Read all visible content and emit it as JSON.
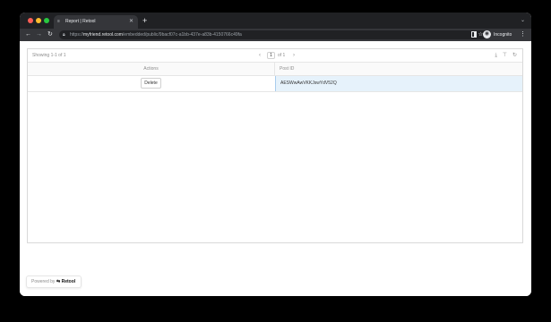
{
  "browser": {
    "traffic_lights": {
      "close_color": "#ff5f57",
      "minimize_color": "#febc2e",
      "zoom_color": "#28c840"
    },
    "tab": {
      "title": "Report | Retool",
      "favicon": "retool-icon"
    },
    "new_tab_symbol": "+",
    "url": {
      "scheme": "https://",
      "host": "myfriend.retool.com",
      "path": "/embedded/public/9bacf07c-a1bb-437e-a83b-4150766c49fa"
    },
    "profile_label": "Incognito"
  },
  "table": {
    "showing_text": "Showing 1-1 of 1",
    "pagination": {
      "current_page": "1",
      "total_text": "of 1"
    },
    "columns": [
      "Actions",
      "Post ID"
    ],
    "rows": [
      {
        "action_label": "Delete",
        "post_id": "AESWwAwVKKJswYdV52Q"
      }
    ]
  },
  "footer": {
    "powered_by": "Powered by",
    "brand": "Retool"
  },
  "colors": {
    "selected_cell_bg": "#e6f2fb",
    "tabbar_bg": "#202124",
    "toolbar_bg": "#35363a"
  }
}
